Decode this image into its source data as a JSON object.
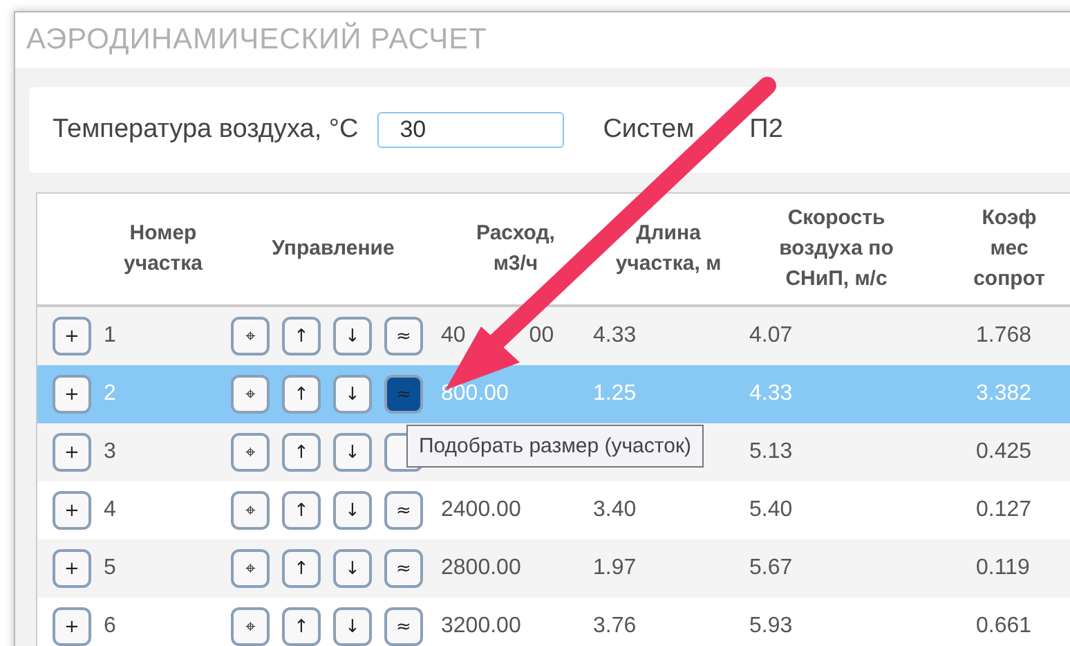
{
  "window": {
    "title": "АЭРОДИНАМИЧЕСКИЙ РАСЧЕТ"
  },
  "params": {
    "temperature_label": "Температура воздуха, °C",
    "temperature_value": "30",
    "system_label_parts": [
      "Систем",
      "П2"
    ]
  },
  "table": {
    "columns": [
      {
        "lines": [
          "Номер",
          "участка"
        ]
      },
      {
        "lines": [
          "Управление"
        ]
      },
      {
        "lines": [
          "Расход,",
          "м3/ч"
        ]
      },
      {
        "lines": [
          "Длина",
          "участка, м"
        ]
      },
      {
        "lines": [
          "Скорость",
          "воздуха по",
          "СНиП, м/с"
        ]
      },
      {
        "lines": [
          "Коэф",
          "мес",
          "сопрот"
        ]
      }
    ],
    "rows": [
      {
        "selected": false,
        "add": "+",
        "number": "1",
        "controls": [
          {
            "label": "⌖",
            "pressed": false
          },
          {
            "label": "↑",
            "pressed": false
          },
          {
            "label": "↓",
            "pressed": false
          },
          {
            "label": "≈",
            "pressed": false
          }
        ],
        "flow": [
          "40",
          "00"
        ],
        "length": "4.33",
        "speed": "4.07",
        "coeff": "1.768"
      },
      {
        "selected": true,
        "add": "+",
        "number": "2",
        "controls": [
          {
            "label": "⌖",
            "pressed": false
          },
          {
            "label": "↑",
            "pressed": false
          },
          {
            "label": "↓",
            "pressed": false
          },
          {
            "label": "≈",
            "pressed": true
          }
        ],
        "flow": [
          "800.00"
        ],
        "length": "1.25",
        "speed": "4.33",
        "coeff": "3.382"
      },
      {
        "selected": false,
        "add": "+",
        "number": "3",
        "controls": [
          {
            "label": "⌖",
            "pressed": false
          },
          {
            "label": "↑",
            "pressed": false
          },
          {
            "label": "↓",
            "pressed": false
          },
          {
            "pressed": false
          }
        ],
        "speed": "5.13",
        "coeff": "0.425"
      },
      {
        "selected": false,
        "add": "+",
        "number": "4",
        "controls": [
          {
            "label": "⌖",
            "pressed": false
          },
          {
            "label": "↑",
            "pressed": false
          },
          {
            "label": "↓",
            "pressed": false
          },
          {
            "label": "≈",
            "pressed": false
          }
        ],
        "flow": [
          "2400.00"
        ],
        "length": "3.40",
        "speed": "5.40",
        "coeff": "0.127"
      },
      {
        "selected": false,
        "add": "+",
        "number": "5",
        "controls": [
          {
            "label": "⌖",
            "pressed": false
          },
          {
            "label": "↑",
            "pressed": false
          },
          {
            "label": "↓",
            "pressed": false
          },
          {
            "label": "≈",
            "pressed": false
          }
        ],
        "flow": [
          "2800.00"
        ],
        "length": "1.97",
        "speed": "5.67",
        "coeff": "0.119"
      },
      {
        "selected": false,
        "add": "+",
        "number": "6",
        "controls": [
          {
            "label": "⌖",
            "pressed": false
          },
          {
            "label": "↑",
            "pressed": false
          },
          {
            "label": "↓",
            "pressed": false
          },
          {
            "label": "≈",
            "pressed": false
          }
        ],
        "flow": [
          "3200.00"
        ],
        "length": "3.76",
        "speed": "5.93",
        "coeff": "0.661"
      }
    ]
  },
  "tooltip": {
    "text": "Подобрать размер (участок)"
  }
}
